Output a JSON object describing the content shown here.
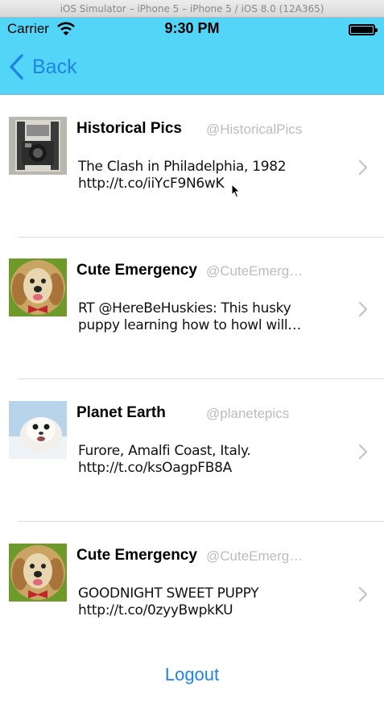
{
  "simulator": {
    "title": "iOS Simulator – iPhone 5 – iPhone 5 / iOS 8.0 (12A365)"
  },
  "status_bar": {
    "carrier": "Carrier",
    "time": "9:30 PM"
  },
  "nav": {
    "back_label": "Back"
  },
  "tweets": [
    {
      "name": "Historical Pics",
      "handle": "@HistoricalPics",
      "text": "The Clash in Philadelphia, 1982 http://t.co/iiYcF9N6wK",
      "avatar": "camera"
    },
    {
      "name": "Cute Emergency",
      "handle": "@CuteEmergency",
      "text": "RT @HereBeHuskies: This husky puppy learning how to howl will…",
      "avatar": "puppy"
    },
    {
      "name": "Planet Earth",
      "handle": "@planetepics",
      "text": "Furore, Amalfi Coast, Italy. http://t.co/ksOagpFB8A",
      "avatar": "seal"
    },
    {
      "name": "Cute Emergency",
      "handle": "@CuteEmergency",
      "text": "GOODNIGHT SWEET PUPPY http://t.co/0zyyBwpkKU",
      "avatar": "puppy"
    }
  ],
  "logout": {
    "label": "Logout"
  },
  "colors": {
    "bar": "#53d5f8",
    "tint": "#1f83e6",
    "handle": "#bcbcbc",
    "chevron": "#c7c7cc"
  }
}
